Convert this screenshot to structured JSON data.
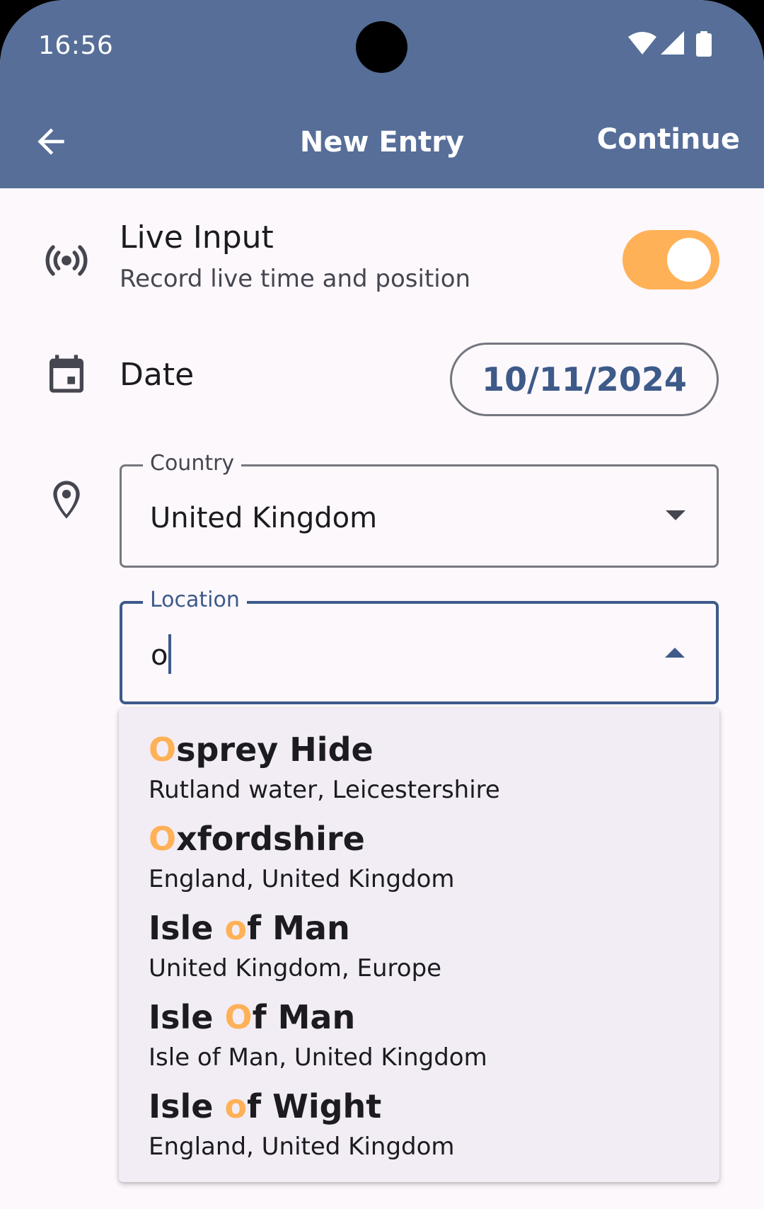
{
  "status_bar": {
    "time": "16:56",
    "icons": [
      "wifi-icon",
      "signal-icon",
      "battery-icon"
    ]
  },
  "app_bar": {
    "title": "New Entry",
    "action_label": "Continue",
    "back_icon": "arrow-back-icon"
  },
  "live_input": {
    "title": "Live Input",
    "subtitle": "Record live time and position",
    "enabled": true,
    "icon": "broadcast-icon"
  },
  "date": {
    "label": "Date",
    "value": "10/11/2024",
    "icon": "calendar-icon"
  },
  "country": {
    "label": "Country",
    "value": "United Kingdom",
    "icon": "location-pin-icon"
  },
  "location": {
    "label": "Location",
    "value": "o"
  },
  "suggestions": [
    {
      "before": "",
      "match": "O",
      "after": "sprey Hide",
      "subtitle": "Rutland water, Leicestershire"
    },
    {
      "before": "",
      "match": "O",
      "after": "xfordshire",
      "subtitle": "England, United Kingdom"
    },
    {
      "before": "Isle ",
      "match": "o",
      "after": "f Man",
      "subtitle": "United Kingdom, Europe"
    },
    {
      "before": "Isle ",
      "match": "O",
      "after": "f Man",
      "subtitle": "Isle of Man, United Kingdom"
    },
    {
      "before": "Isle ",
      "match": "o",
      "after": "f Wight",
      "subtitle": "England, United Kingdom"
    }
  ],
  "colors": {
    "app_bar": "#566e98",
    "accent": "#ffb158",
    "primary": "#3d5a89",
    "background": "#fdf8fc"
  }
}
